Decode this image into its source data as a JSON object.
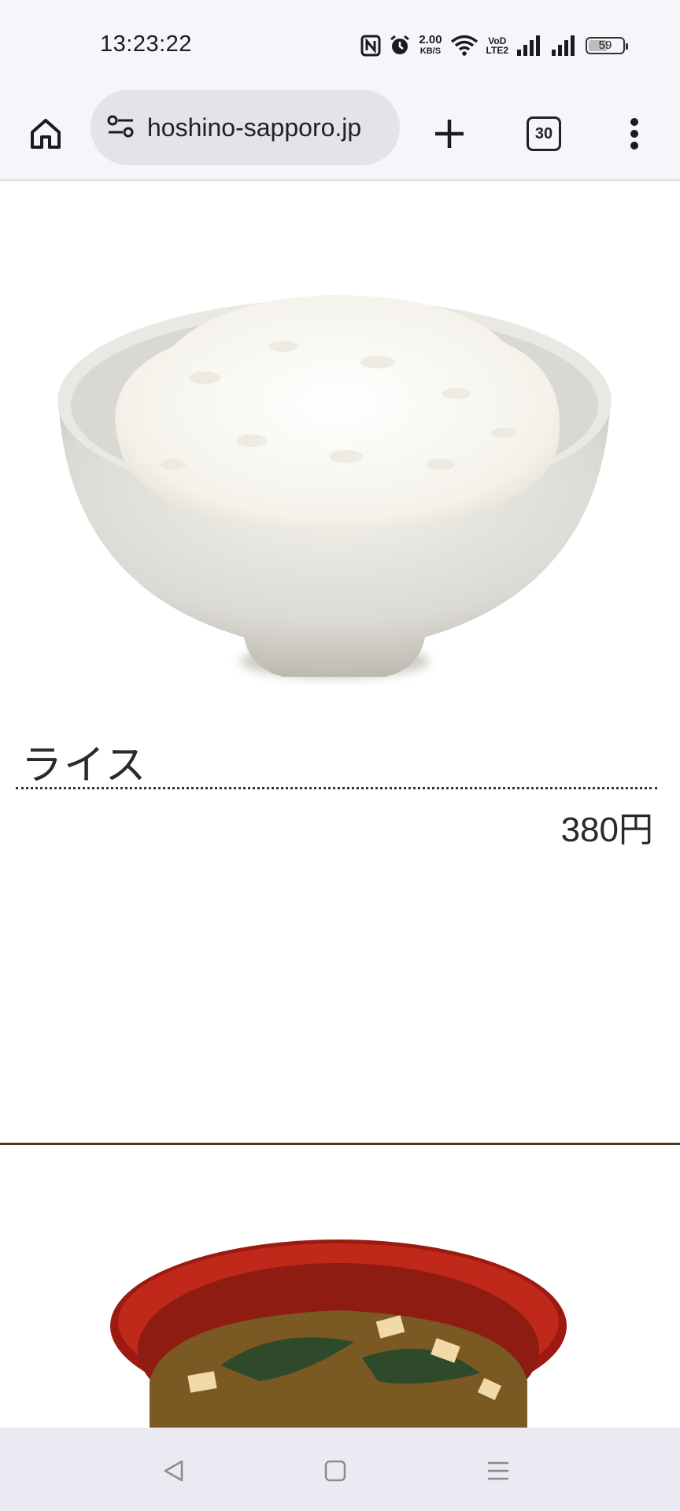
{
  "status_bar": {
    "time": "13:23:22",
    "net_speed_value": "2.00",
    "net_speed_unit": "KB/S",
    "volte_top": "VoD",
    "volte_bottom": "LTE2",
    "battery_level": "59",
    "icons": [
      "nfc-icon",
      "alarm-icon",
      "wifi-icon",
      "signal-icon",
      "signal-icon",
      "battery-icon"
    ]
  },
  "browser": {
    "url": "hoshino-sapporo.jp",
    "tab_count": "30",
    "icons": [
      "home-icon",
      "site-settings-icon",
      "plus-icon",
      "tab-switcher-icon",
      "more-vert-icon"
    ]
  },
  "menu_item": {
    "name": "ライス",
    "price": "380円"
  },
  "nav_bar": {
    "icons": [
      "back-icon",
      "home-icon",
      "recents-icon"
    ]
  },
  "colors": {
    "section_divider": "#4a3a1e",
    "bowl_red": "#c0281a"
  }
}
